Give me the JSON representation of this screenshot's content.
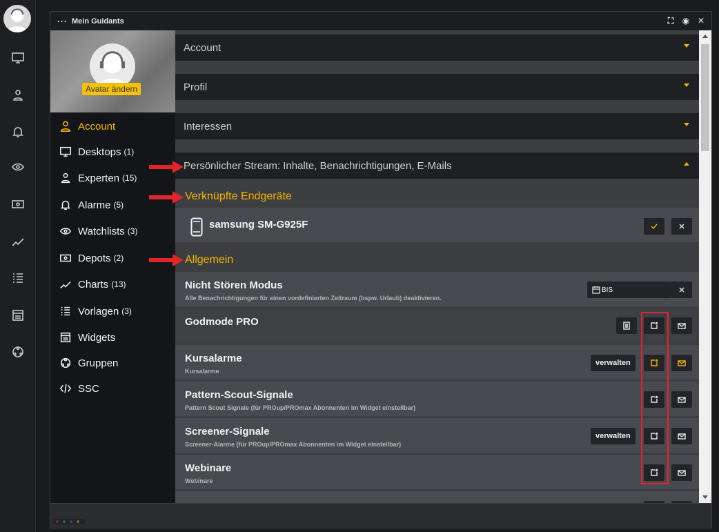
{
  "window": {
    "title": "Mein Guidants"
  },
  "avatar": {
    "change_label": "Avatar ändern"
  },
  "nav": [
    {
      "label": "Account",
      "count": "",
      "icon": "user-icon",
      "active": true
    },
    {
      "label": "Desktops",
      "count": "(1)",
      "icon": "monitor-icon"
    },
    {
      "label": "Experten",
      "count": "(15)",
      "icon": "expert-icon"
    },
    {
      "label": "Alarme",
      "count": "(5)",
      "icon": "bell-icon"
    },
    {
      "label": "Watchlists",
      "count": "(3)",
      "icon": "eye-icon"
    },
    {
      "label": "Depots",
      "count": "(2)",
      "icon": "money-icon"
    },
    {
      "label": "Charts",
      "count": "(13)",
      "icon": "chart-line-icon"
    },
    {
      "label": "Vorlagen",
      "count": "(3)",
      "icon": "list-icon"
    },
    {
      "label": "Widgets",
      "count": "",
      "icon": "widget-icon"
    },
    {
      "label": "Gruppen",
      "count": "",
      "icon": "group-icon"
    },
    {
      "label": "SSC",
      "count": "",
      "icon": "code-icon"
    }
  ],
  "accordions": [
    {
      "label": "Account"
    },
    {
      "label": "Profil"
    },
    {
      "label": "Interessen"
    },
    {
      "label": "Persönlicher Stream: Inhalte, Benachrichtigungen, E-Mails"
    }
  ],
  "devices": {
    "title": "Verknüpfte Endgeräte",
    "device_name": "samsung SM-G925F"
  },
  "general": {
    "title": "Allgemein",
    "rows": [
      {
        "title": "Nicht Stören Modus",
        "subtitle": "Alle Benachrichtigungen für einen vordefinierten Zeitraum (bspw. Urlaub) deaktivieren."
      },
      {
        "title": "Godmode PRO",
        "subtitle": ""
      },
      {
        "title": "Kursalarme",
        "subtitle": "Kursalarme"
      },
      {
        "title": "Pattern-Scout-Signale",
        "subtitle": "Pattern Scout Signale (für PROup/PROmax Abonnenten im Widget einstellbar)"
      },
      {
        "title": "Screener-Signale",
        "subtitle": "Screener-Alarme (für PROup/PROmax Abonnenten im Widget einstellbar)"
      },
      {
        "title": "Webinare",
        "subtitle": "Webinare"
      }
    ],
    "bis_label": "BIS",
    "manage_label": "verwalten"
  },
  "colors": {
    "accent": "#f4b400",
    "highlight": "#e0262a"
  }
}
